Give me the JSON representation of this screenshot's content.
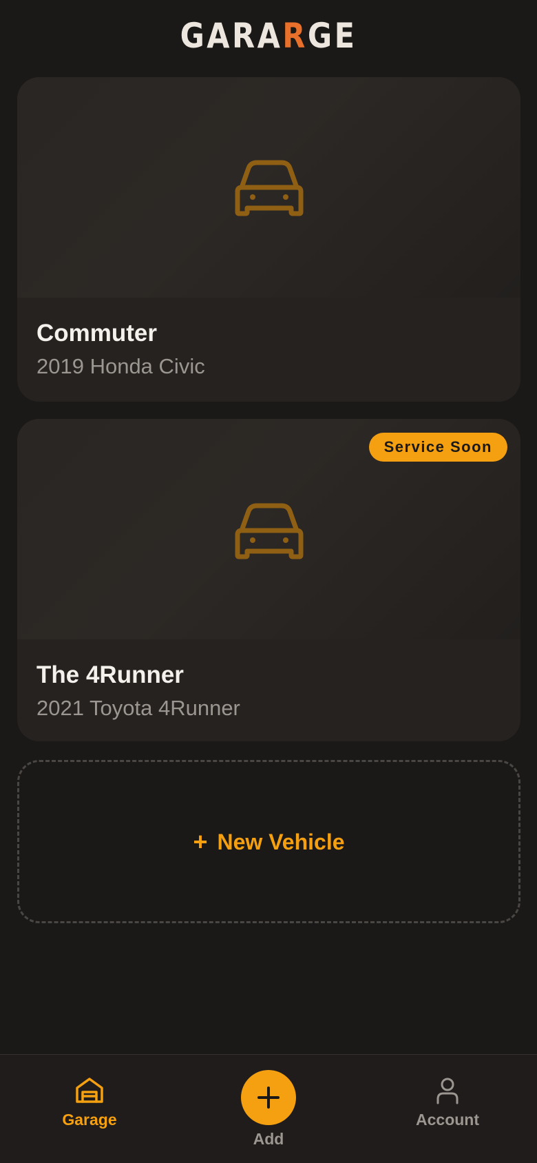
{
  "header": {
    "logo_prefix": "GARA",
    "logo_accent": "R",
    "logo_suffix": "GE"
  },
  "vehicles": [
    {
      "name": "Commuter",
      "description": "2019 Honda Civic",
      "badge": null
    },
    {
      "name": "The 4Runner",
      "description": "2021 Toyota 4Runner",
      "badge": "Service Soon"
    }
  ],
  "add_card": {
    "plus": "+",
    "label": "New Vehicle"
  },
  "bottom_nav": {
    "garage": {
      "label": "Garage",
      "icon": "garage-icon",
      "active": true
    },
    "add": {
      "label": "Add",
      "icon": "plus-icon"
    },
    "account": {
      "label": "Account",
      "icon": "user-icon",
      "active": false
    }
  },
  "colors": {
    "background": "#1b1918",
    "card": "#262220",
    "accent": "#f5a011",
    "logo_accent": "#e8702a",
    "car_icon": "#8f5f14",
    "muted_text": "#9c9691"
  }
}
